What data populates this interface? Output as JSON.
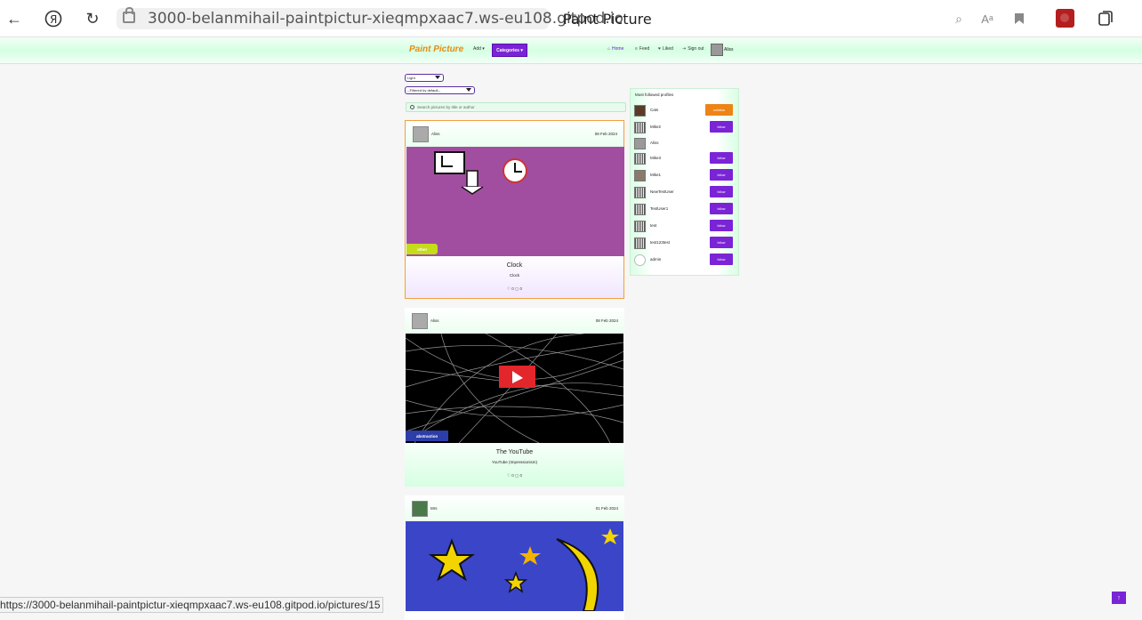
{
  "browser": {
    "url": "3000-belanmihail-paintpictur-xieqmpxaac7.ws-eu108.gitpod.io",
    "tab_title": "Paint Picture",
    "status_url": "https://3000-belanmihail-paintpictur-xieqmpxaac7.ws-eu108.gitpod.io/pictures/15",
    "icons": [
      "back-icon",
      "yandex-icon",
      "reload-icon",
      "lock-icon",
      "search-icon",
      "translate-icon",
      "bookmark-icon",
      "collections-icon"
    ]
  },
  "navbar": {
    "brand": "Paint Picture",
    "add_label": "Add ▾",
    "categories_label": "Categories ▾",
    "home": "Home",
    "feed": "Feed",
    "liked": "Liked",
    "signout": "Sign out",
    "user": "Aliss"
  },
  "controls": {
    "theme": "Light",
    "filter": "--Filtered by default--",
    "search_placeholder": "Search pictures by title or author"
  },
  "posts": [
    {
      "author": "Aliss",
      "date": "08 Feb 2024",
      "category": "other",
      "title": "Clock",
      "subtitle": "Clock",
      "likes": "0",
      "comments": "0"
    },
    {
      "author": "Aliss",
      "date": "08 Feb 2024",
      "category": "abstraction",
      "title": "The YouTube",
      "subtitle": "YouTube (Impressionism)",
      "likes": "0",
      "comments": "0"
    },
    {
      "author": "Mrs",
      "date": "01 Feb 2024"
    }
  ],
  "sidebar": {
    "heading": "Most followed profiles",
    "profiles": [
      {
        "name": "Cats",
        "button": "unfollow"
      },
      {
        "name": "Mike2",
        "button": "follow"
      },
      {
        "name": "Aliss",
        "button": ""
      },
      {
        "name": "Mike3",
        "button": "follow"
      },
      {
        "name": "Mike1",
        "button": "follow"
      },
      {
        "name": "NewTestUser",
        "button": "follow"
      },
      {
        "name": "TestUser1",
        "button": "follow"
      },
      {
        "name": "test",
        "button": "follow"
      },
      {
        "name": "test123test",
        "button": "follow"
      },
      {
        "name": "admin",
        "button": "follow"
      }
    ]
  },
  "back_to_top": "↑",
  "colors": {
    "accent": "#7a24d6",
    "brand": "#e88b16",
    "nav_bg": "#d4ffe2"
  }
}
